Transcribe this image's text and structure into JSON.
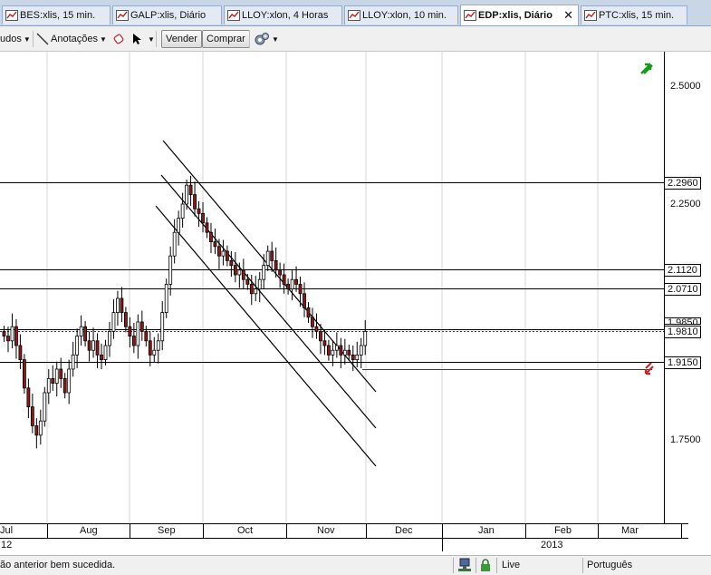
{
  "tabs": [
    {
      "label": "BES:xlis, 15 min.",
      "active": false
    },
    {
      "label": "GALP:xlis, Diário",
      "active": false
    },
    {
      "label": "LLOY:xlon, 4 Horas",
      "active": false
    },
    {
      "label": "LLOY:xlon, 10 min.",
      "active": false
    },
    {
      "label": "EDP:xlis, Diário",
      "active": true,
      "close": "✕"
    },
    {
      "label": "PTC:xlis, 15 min.",
      "active": false
    }
  ],
  "toolbar": {
    "studies_label": "udos",
    "annotations_label": "Anotações",
    "sell_label": "Vender",
    "buy_label": "Comprar"
  },
  "price_axis": {
    "ticks": [
      "2.5000",
      "2.2500",
      "1.7500"
    ],
    "levels": [
      "2.2960",
      "2.1120",
      "2.0710",
      "1.9850",
      "1.9810",
      "1.9150"
    ]
  },
  "time_axis": {
    "months": [
      "Jul",
      "Aug",
      "Sep",
      "Oct",
      "Nov",
      "Dec",
      "Jan",
      "Feb",
      "Mar"
    ],
    "years": [
      "12",
      "2013"
    ]
  },
  "status": {
    "message": "ão anterior bem sucedida.",
    "connection": "Live",
    "language": "Português"
  },
  "colors": {
    "tab_bar": "#c9d6e6",
    "bull_candle": "#ffffff",
    "bear_candle": "#8b1a1a",
    "level_line": "#000000",
    "last_price_line": "#cc0000",
    "signal_up": "#1a9a1a",
    "signal_down": "#d42020"
  },
  "chart_data": {
    "type": "candlestick",
    "title": "EDP:xlis, Diário",
    "ylim": [
      1.66,
      2.57
    ],
    "y_ticks": [
      2.5,
      2.25,
      1.75
    ],
    "horizontal_levels": [
      2.296,
      2.112,
      2.071,
      1.985,
      1.981,
      1.915
    ],
    "last_price": 1.981,
    "x_labels": [
      "Jul",
      "Aug",
      "Sep",
      "Oct",
      "Nov",
      "Dec",
      "Jan",
      "Feb",
      "Mar"
    ],
    "channel_lines": "three parallel descending trend lines from early Sep to late Nov",
    "close": [
      1.97,
      1.96,
      1.99,
      1.95,
      1.92,
      1.86,
      1.82,
      1.78,
      1.76,
      1.79,
      1.85,
      1.88,
      1.87,
      1.9,
      1.88,
      1.85,
      1.9,
      1.93,
      1.97,
      1.99,
      1.96,
      1.94,
      1.96,
      1.93,
      1.92,
      1.95,
      1.98,
      2.02,
      2.05,
      2.02,
      1.99,
      1.97,
      1.95,
      2.0,
      1.98,
      1.96,
      1.93,
      1.94,
      1.96,
      2.02,
      2.08,
      2.14,
      2.19,
      2.22,
      2.25,
      2.29,
      2.27,
      2.24,
      2.23,
      2.21,
      2.19,
      2.17,
      2.16,
      2.14,
      2.15,
      2.13,
      2.12,
      2.1,
      2.11,
      2.09,
      2.08,
      2.06,
      2.07,
      2.09,
      2.12,
      2.15,
      2.13,
      2.11,
      2.1,
      2.08,
      2.07,
      2.09,
      2.08,
      2.06,
      2.03,
      2.01,
      1.99,
      1.98,
      1.96,
      1.95,
      1.93,
      1.94,
      1.95,
      1.93,
      1.94,
      1.93,
      1.92,
      1.93,
      1.95,
      1.98
    ]
  }
}
